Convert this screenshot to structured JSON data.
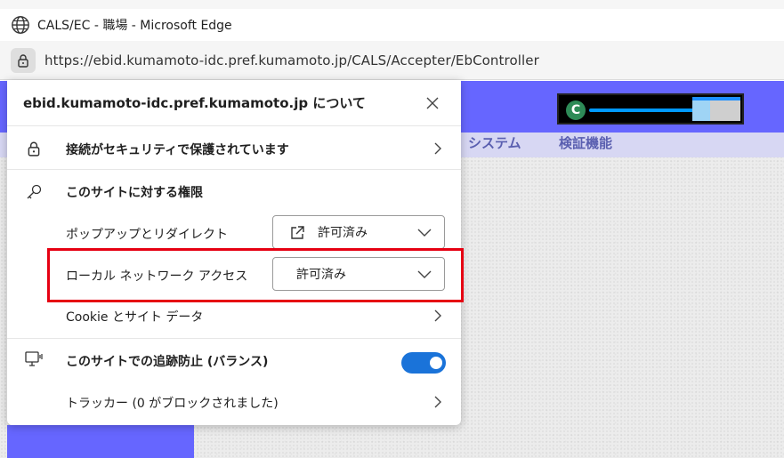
{
  "window": {
    "title": "CALS/EC - 職場 - Microsoft Edge"
  },
  "address_bar": {
    "url": "https://ebid.kumamoto-idc.pref.kumamoto.jp/CALS/Accepter/EbController"
  },
  "background_page": {
    "menu_items": [
      "システム",
      "検証機能"
    ],
    "colors": {
      "header": "#6666ff",
      "menu_strip": "#d7d7f3"
    }
  },
  "site_info": {
    "title": "ebid.kumamoto-idc.pref.kumamoto.jp について",
    "connection": "接続がセキュリティで保護されています",
    "permissions_heading": "このサイトに対する権限",
    "popups": {
      "label": "ポップアップとリダイレクト",
      "value": "許可済み"
    },
    "local_network": {
      "label": "ローカル ネットワーク アクセス",
      "value": "許可済み"
    },
    "cookies": "Cookie とサイト データ",
    "tracking": {
      "label": "このサイトでの追跡防止 (バランス)",
      "enabled": true
    },
    "trackers": "トラッカー (0 がブロックされました)"
  },
  "annotation": {
    "highlight_color": "#e60012",
    "toggle_color": "#1a73d9"
  }
}
